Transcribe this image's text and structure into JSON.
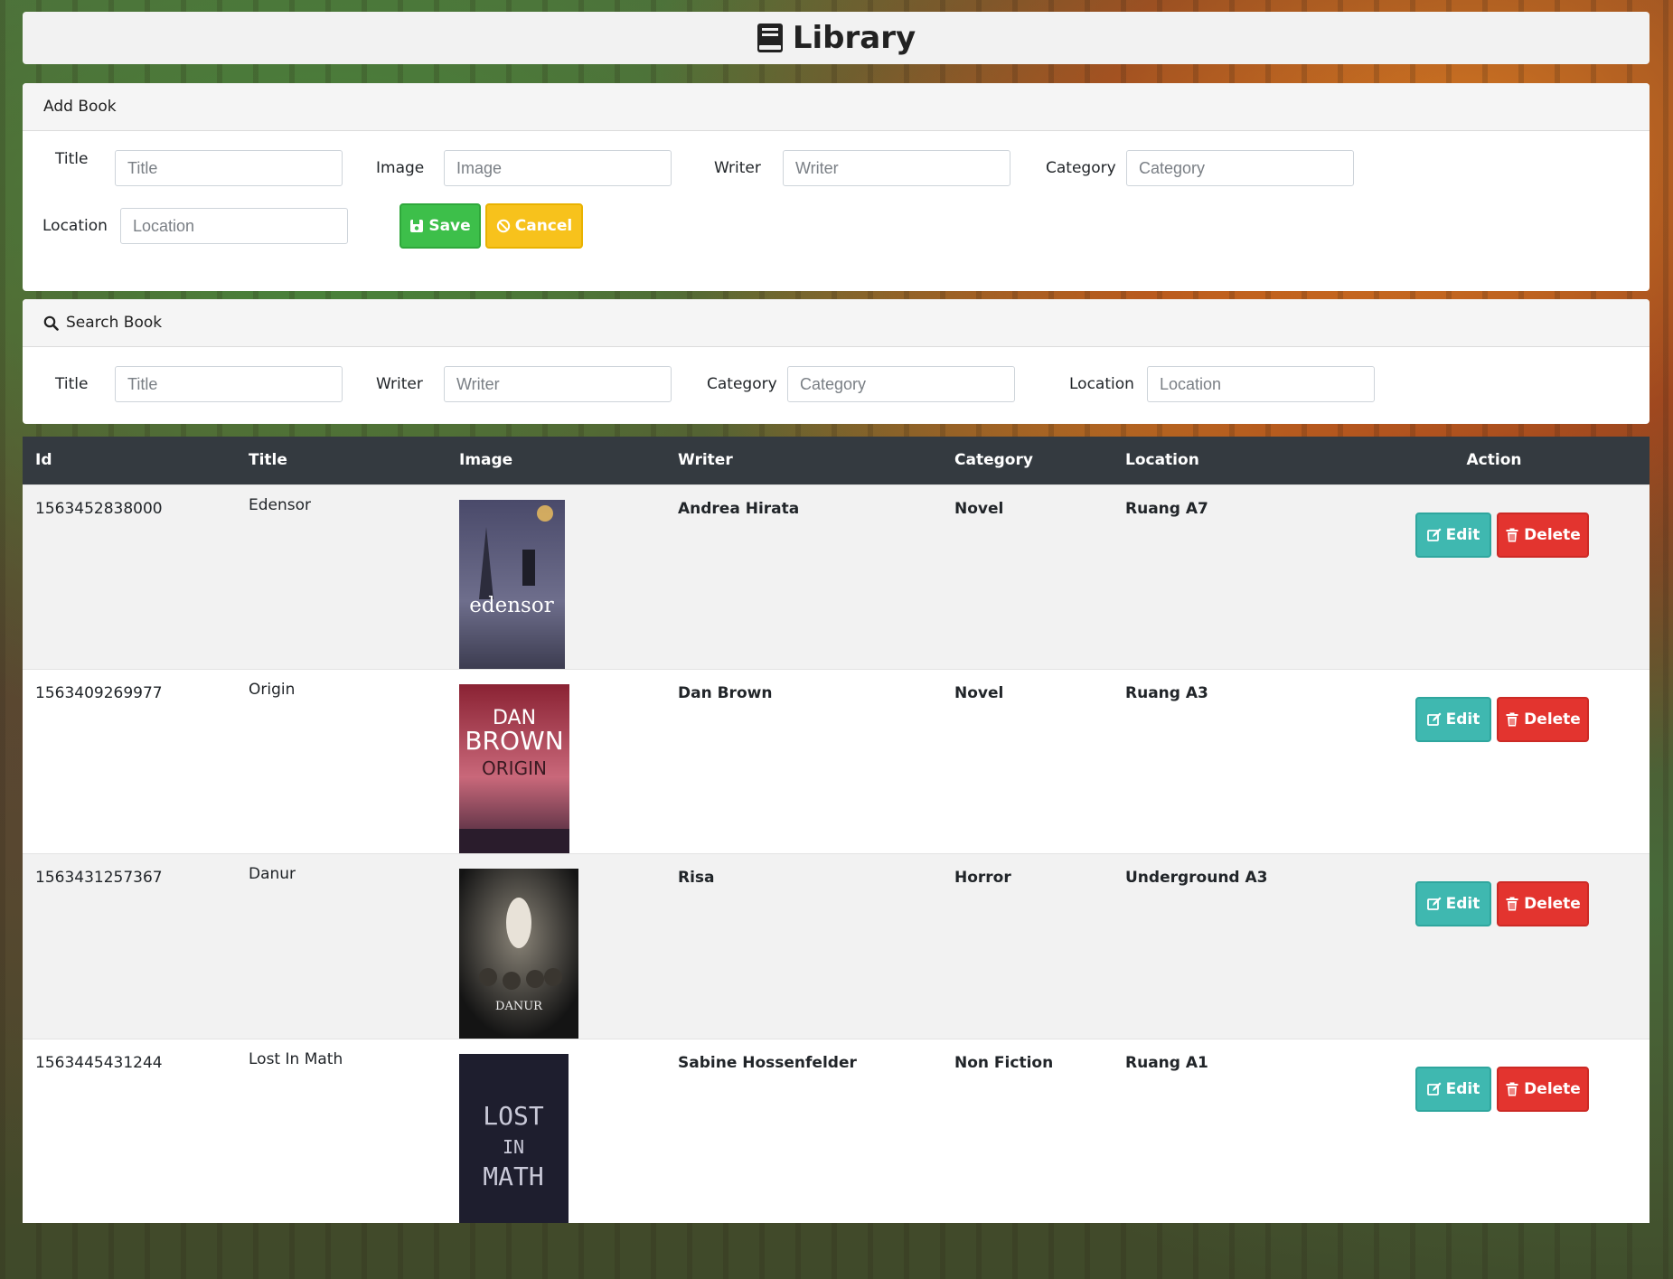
{
  "app": {
    "title": "Library"
  },
  "add_book": {
    "header": "Add Book",
    "fields": {
      "title": {
        "label": "Title",
        "placeholder": "Title",
        "value": ""
      },
      "image": {
        "label": "Image",
        "placeholder": "Image",
        "value": ""
      },
      "writer": {
        "label": "Writer",
        "placeholder": "Writer",
        "value": ""
      },
      "category": {
        "label": "Category",
        "placeholder": "Category",
        "value": ""
      },
      "location": {
        "label": "Location",
        "placeholder": "Location",
        "value": ""
      }
    },
    "save_label": "Save",
    "cancel_label": "Cancel"
  },
  "search_book": {
    "header": "Search Book",
    "fields": {
      "title": {
        "label": "Title",
        "placeholder": "Title"
      },
      "writer": {
        "label": "Writer",
        "placeholder": "Writer"
      },
      "category": {
        "label": "Category",
        "placeholder": "Category"
      },
      "location": {
        "label": "Location",
        "placeholder": "Location"
      }
    }
  },
  "table": {
    "columns": [
      "Id",
      "Title",
      "Image",
      "Writer",
      "Category",
      "Location",
      "Action"
    ],
    "edit_label": "Edit",
    "delete_label": "Delete",
    "rows": [
      {
        "id": "1563452838000",
        "title": "Edensor",
        "writer": "Andrea Hirata",
        "category": "Novel",
        "location": "Ruang A7",
        "cover": {
          "text": [
            "edensor"
          ],
          "bg": "#5a5a78"
        }
      },
      {
        "id": "1563409269977",
        "title": "Origin",
        "writer": "Dan Brown",
        "category": "Novel",
        "location": "Ruang A3",
        "cover": {
          "text": [
            "DAN",
            "BROWN",
            "ORIGIN"
          ],
          "bg": "#8a2a3a"
        }
      },
      {
        "id": "1563431257367",
        "title": "Danur",
        "writer": "Risa",
        "category": "Horror",
        "location": "Underground A3",
        "cover": {
          "text": [
            "DANUR"
          ],
          "bg": "#2b2b2b"
        }
      },
      {
        "id": "1563445431244",
        "title": "Lost In Math",
        "writer": "Sabine Hossenfelder",
        "category": "Non Fiction",
        "location": "Ruang A1",
        "cover": {
          "text": [
            "LOST",
            "IN",
            "MATH"
          ],
          "bg": "#1e1e2e"
        }
      }
    ]
  }
}
